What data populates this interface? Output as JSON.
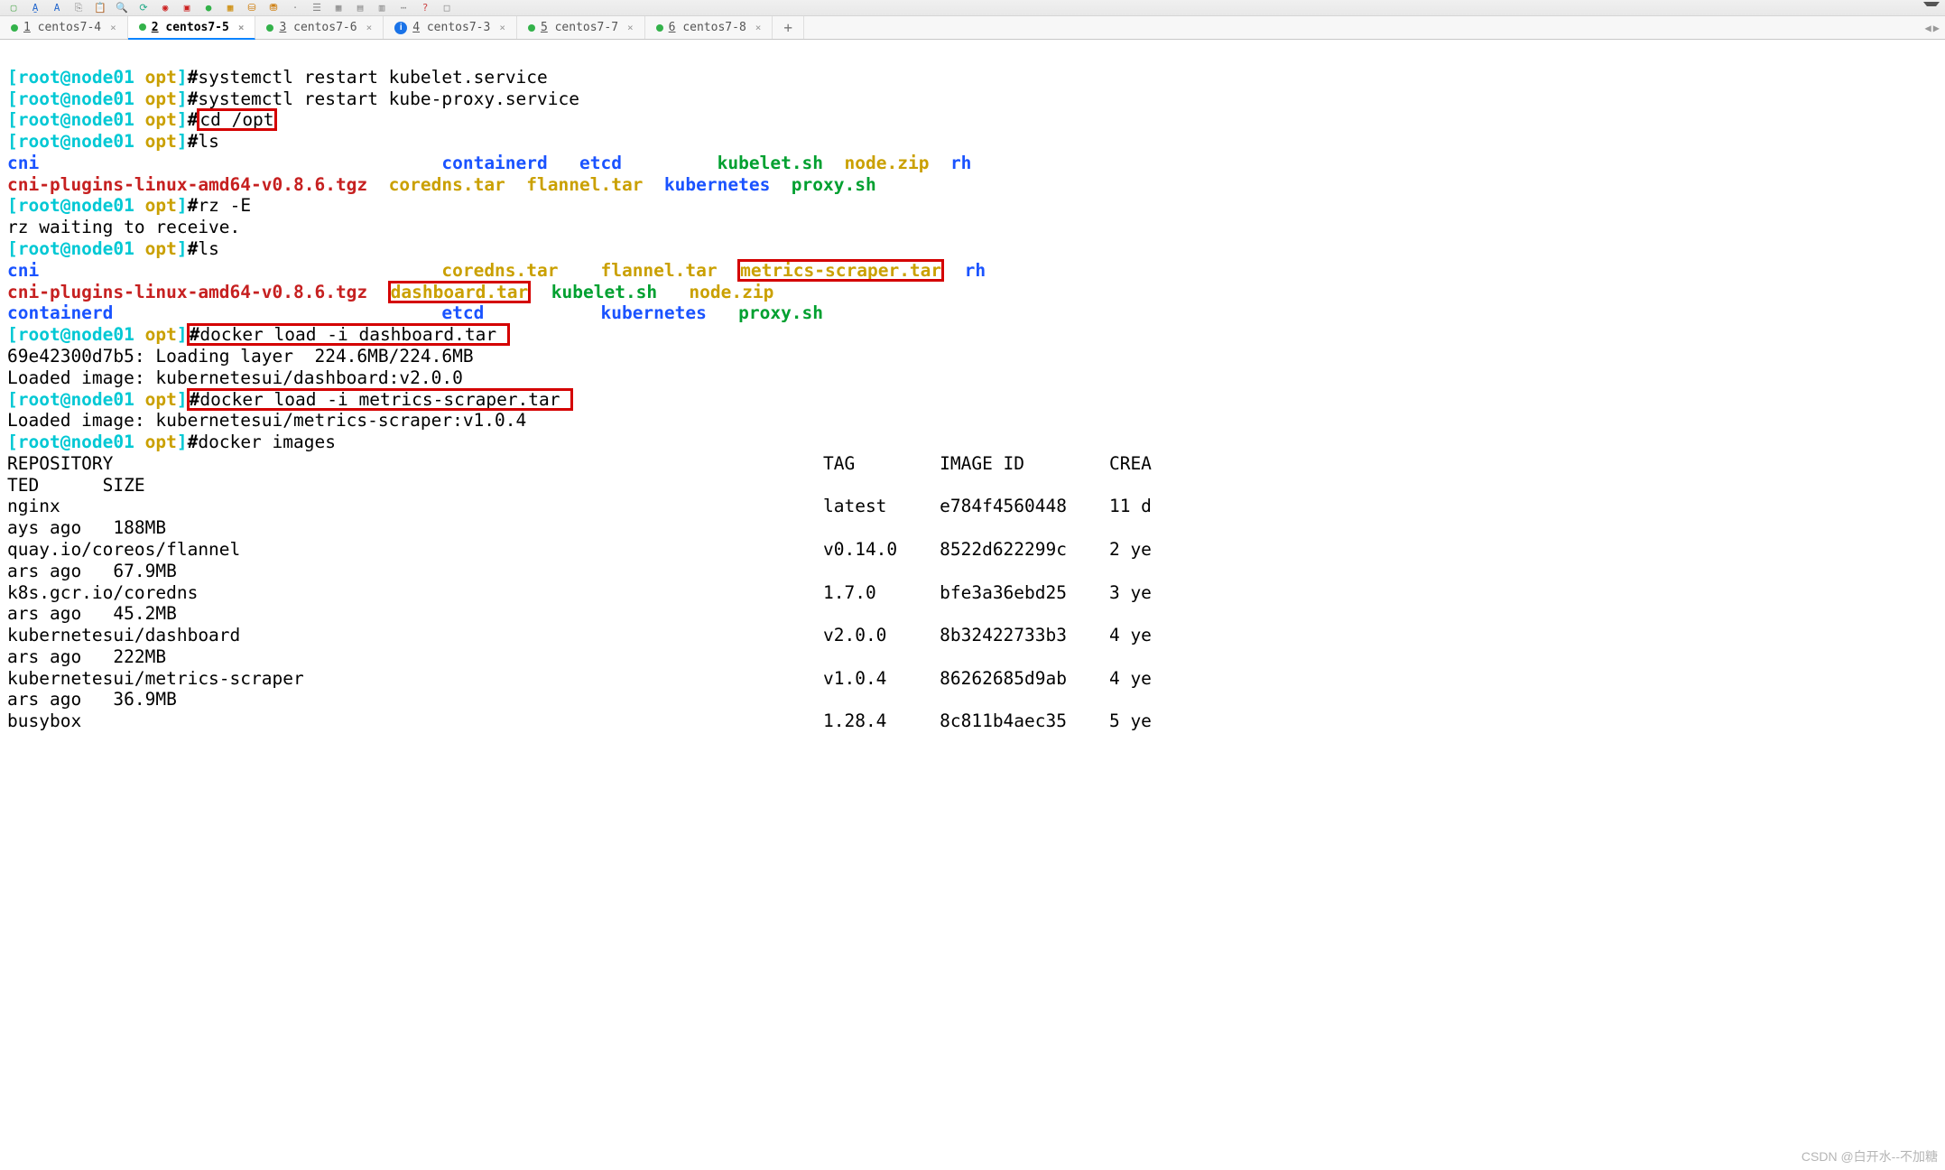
{
  "toolbar_icons": [
    "save-icon",
    "folder-icon",
    "copy-icon",
    "paste-icon",
    "search-icon",
    "text-a-icon",
    "code-icon",
    "reload-icon",
    "run-icon",
    "stop-icon",
    "dot1-icon",
    "dot2-icon",
    "db-icon",
    "db2-icon",
    "sep-icon",
    "list-icon",
    "grid-icon",
    "more-icon",
    "help-icon",
    "app-icon"
  ],
  "tabs": [
    {
      "dot": "green",
      "num": "1",
      "label": "centos7-4",
      "active": false,
      "badge": null
    },
    {
      "dot": "green",
      "num": "2",
      "label": "centos7-5",
      "active": true,
      "badge": null
    },
    {
      "dot": "green",
      "num": "3",
      "label": "centos7-6",
      "active": false,
      "badge": null
    },
    {
      "dot": null,
      "num": "4",
      "label": "centos7-3",
      "active": false,
      "badge": "info"
    },
    {
      "dot": "green",
      "num": "5",
      "label": "centos7-7",
      "active": false,
      "badge": null
    },
    {
      "dot": "green",
      "num": "6",
      "label": "centos7-8",
      "active": false,
      "badge": null
    }
  ],
  "add_tab": "+",
  "nav_prev": "◀",
  "nav_next": "▶",
  "prompt": {
    "user": "[root@node01 ",
    "path": "opt",
    "close": "]",
    "hash": "#"
  },
  "lines": {
    "cmd1": "systemctl restart kubelet.service",
    "cmd2": "systemctl restart kube-proxy.service",
    "cmd3": "cd /opt",
    "cmd4": "ls",
    "ls1_col1a": "cni",
    "ls1_col1b": "cni-plugins-linux-amd64-v0.8.6.tgz",
    "ls1_col2a": "containerd",
    "ls1_col2b": "coredns.tar",
    "ls1_col3a": "etcd",
    "ls1_col3b": "flannel.tar",
    "ls1_col4a": "kubelet.sh",
    "ls1_col4b": "kubernetes",
    "ls1_col5a": "node.zip",
    "ls1_col5b": "proxy.sh",
    "ls1_col6a": "rh",
    "cmd5": "rz -E",
    "rz": "rz waiting to receive.",
    "cmd6": "ls",
    "ls2_r1c1": "cni",
    "ls2_r1c2": "coredns.tar",
    "ls2_r1c3": "flannel.tar",
    "ls2_r1c4": "metrics-scraper.tar",
    "ls2_r1c5": "rh",
    "ls2_r2c1": "cni-plugins-linux-amd64-v0.8.6.tgz",
    "ls2_r2c2": "dashboard.tar",
    "ls2_r2c3": "kubelet.sh",
    "ls2_r2c4": "node.zip",
    "ls2_r3c1": "containerd",
    "ls2_r3c2": "etcd",
    "ls2_r3c3": "kubernetes",
    "ls2_r3c4": "proxy.sh",
    "cmd7": "docker load -i dashboard.tar ",
    "load1": "69e42300d7b5: Loading layer  224.6MB/224.6MB",
    "load2": "Loaded image: kubernetesui/dashboard:v2.0.0",
    "cmd8": "docker load -i metrics-scraper.tar ",
    "load3": "Loaded image: kubernetesui/metrics-scraper:v1.0.4",
    "cmd9": "docker images",
    "hdr": "REPOSITORY                                                                   TAG        IMAGE ID        CREA",
    "hdr2": "TED      SIZE",
    "img1a": "nginx                                                                        latest     e784f4560448    11 d",
    "img1b": "ays ago   188MB",
    "img2a": "quay.io/coreos/flannel                                                       v0.14.0    8522d622299c    2 ye",
    "img2b": "ars ago   67.9MB",
    "img3a": "k8s.gcr.io/coredns                                                           1.7.0      bfe3a36ebd25    3 ye",
    "img3b": "ars ago   45.2MB",
    "img4a": "kubernetesui/dashboard                                                       v2.0.0     8b32422733b3    4 ye",
    "img4b": "ars ago   222MB",
    "img5a": "kubernetesui/metrics-scraper                                                 v1.0.4     86262685d9ab    4 ye",
    "img5b": "ars ago   36.9MB",
    "img6a": "busybox                                                                      1.28.4     8c811b4aec35    5 ye"
  },
  "watermark": "CSDN @白开水--不加糖"
}
